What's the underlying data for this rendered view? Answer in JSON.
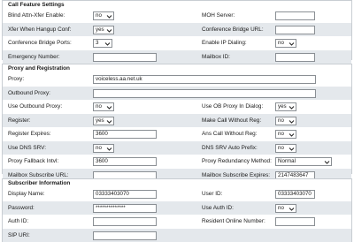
{
  "call_feature": {
    "title": "Call Feature Settings",
    "blind_attn_xfer_enable": {
      "label": "Blind Attn-Xfer Enable:",
      "value": "no"
    },
    "moh_server": {
      "label": "MOH Server:",
      "value": ""
    },
    "xfer_when_hangup_conf": {
      "label": "Xfer When Hangup Conf:",
      "value": "yes"
    },
    "conference_bridge_url": {
      "label": "Conference Bridge URL:",
      "value": ""
    },
    "conference_bridge_ports": {
      "label": "Conference Bridge Ports:",
      "value": "3"
    },
    "enable_ip_dialing": {
      "label": "Enable IP Dialing:",
      "value": "no"
    },
    "emergency_number": {
      "label": "Emergency Number:",
      "value": ""
    },
    "mailbox_id": {
      "label": "Mailbox ID:",
      "value": ""
    }
  },
  "proxy": {
    "title": "Proxy and Registration",
    "proxy": {
      "label": "Proxy:",
      "value": "voiceless.aa.net.uk"
    },
    "outbound_proxy": {
      "label": "Outbound Proxy:",
      "value": ""
    },
    "use_outbound_proxy": {
      "label": "Use Outbound Proxy:",
      "value": "no"
    },
    "use_ob_proxy_in_dialog": {
      "label": "Use OB Proxy In Dialog:",
      "value": "yes"
    },
    "register": {
      "label": "Register:",
      "value": "yes"
    },
    "make_call_without_reg": {
      "label": "Make Call Without Reg:",
      "value": "no"
    },
    "register_expires": {
      "label": "Register Expires:",
      "value": "3600"
    },
    "ans_call_without_reg": {
      "label": "Ans Call Without Reg:",
      "value": "no"
    },
    "use_dns_srv": {
      "label": "Use DNS SRV:",
      "value": "no"
    },
    "dns_srv_auto_prefix": {
      "label": "DNS SRV Auto Prefix:",
      "value": "no"
    },
    "proxy_fallback_intvl": {
      "label": "Proxy Fallback Intvl:",
      "value": "3600"
    },
    "proxy_redundancy_method": {
      "label": "Proxy Redundancy Method:",
      "value": "Normal"
    },
    "mailbox_subscribe_url": {
      "label": "Mailbox Subscribe URL:",
      "value": ""
    },
    "mailbox_subscribe_expires": {
      "label": "Mailbox Subscribe Expires:",
      "value": "2147483647"
    }
  },
  "subscriber": {
    "title": "Subscriber Information",
    "display_name": {
      "label": "Display Name:",
      "value": "03333403070"
    },
    "user_id": {
      "label": "User ID:",
      "value": "03333403070"
    },
    "password": {
      "label": "Password:",
      "value": "**************"
    },
    "use_auth_id": {
      "label": "Use Auth ID:",
      "value": "no"
    },
    "auth_id": {
      "label": "Auth ID:",
      "value": ""
    },
    "resident_online_number": {
      "label": "Resident Online Number:",
      "value": ""
    },
    "sip_uri": {
      "label": "SIP URI:",
      "value": ""
    }
  },
  "icons": {
    "dropdown": "chevron-down-icon"
  },
  "colors": {
    "row_alt": "#e4e8ec",
    "border": "#c8cdd2",
    "field_border": "#8a8f94"
  }
}
